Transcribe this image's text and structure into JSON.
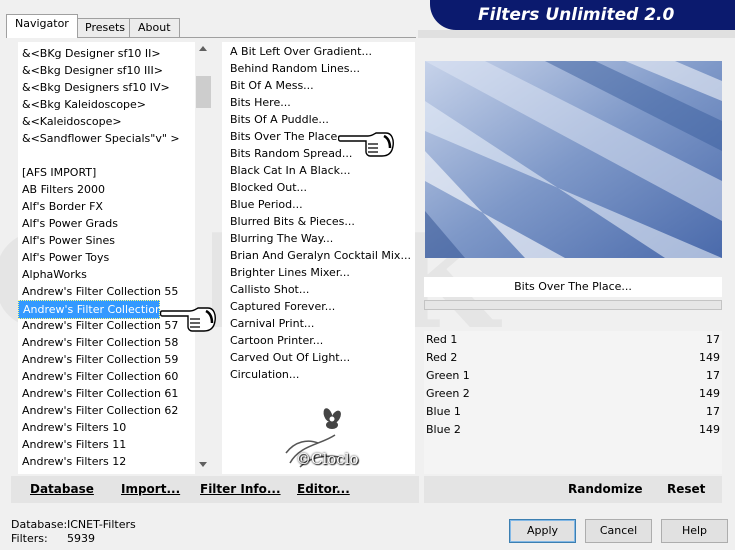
{
  "tabs": [
    "Navigator",
    "Presets",
    "About"
  ],
  "banner_title": "Filters Unlimited 2.0",
  "categories": [
    "&<BKg Designer sf10 II>",
    "&<Bkg Designer sf10 III>",
    "&<Bkg Designers sf10 IV>",
    "&<Bkg Kaleidoscope>",
    "&<Kaleidoscope>",
    "&<Sandflower Specials\"v\" >",
    "",
    "[AFS IMPORT]",
    "AB Filters 2000",
    "Alf's Border FX",
    "Alf's Power Grads",
    "Alf's Power Sines",
    "Alf's Power Toys",
    "AlphaWorks",
    "Andrew's Filter Collection 55",
    "Andrew's Filter Collection 56",
    "Andrew's Filter Collection 57",
    "Andrew's Filter Collection 58",
    "Andrew's Filter Collection 59",
    "Andrew's Filter Collection 60",
    "Andrew's Filter Collection 61",
    "Andrew's Filter Collection 62",
    "Andrew's Filters 10",
    "Andrew's Filters 11",
    "Andrew's Filters 12",
    "Andrew's Filters 13"
  ],
  "selected_category": "Andrew's Filter Collection 56",
  "filters": [
    "A Bit Left Over Gradient...",
    "Behind Random Lines...",
    "Bit Of A Mess...",
    "Bits Here...",
    "Bits Of A Puddle...",
    "Bits Over The Place...",
    "Bits Random Spread...",
    "Black Cat In A Black...",
    "Blocked Out...",
    "Blue Period...",
    "Blurred Bits & Pieces...",
    "Blurring The Way...",
    "Brian And Geralyn Cocktail Mix...",
    "Brighter Lines Mixer...",
    "Callisto Shot...",
    "Captured Forever...",
    "Carnival Print...",
    "Cartoon Printer...",
    "Carved Out Of Light...",
    "Circulation..."
  ],
  "selected_filter": "Bits Over The Place...",
  "params": [
    {
      "label": "Red 1",
      "value": "17"
    },
    {
      "label": "Red 2",
      "value": "149"
    },
    {
      "label": "Green 1",
      "value": "17"
    },
    {
      "label": "Green 2",
      "value": "149"
    },
    {
      "label": "Blue 1",
      "value": "17"
    },
    {
      "label": "Blue 2",
      "value": "149"
    }
  ],
  "buttons": {
    "database": "Database",
    "import": "Import...",
    "filter_info": "Filter Info...",
    "editor": "Editor...",
    "randomize": "Randomize",
    "reset": "Reset",
    "apply": "Apply",
    "cancel": "Cancel",
    "help": "Help"
  },
  "status": {
    "database_label": "Database:",
    "database_value": "ICNET-Filters",
    "filters_label": "Filters:",
    "filters_value": "5939"
  },
  "watermark_signature": "©Cloclo",
  "colors": {
    "banner": "#0b1a6e",
    "selection": "#3399ff",
    "preview_dark": "#3a5d9e",
    "preview_light": "#dfe6f4"
  },
  "icons": [
    "pointing-hand-icon",
    "flower-logo-icon"
  ]
}
